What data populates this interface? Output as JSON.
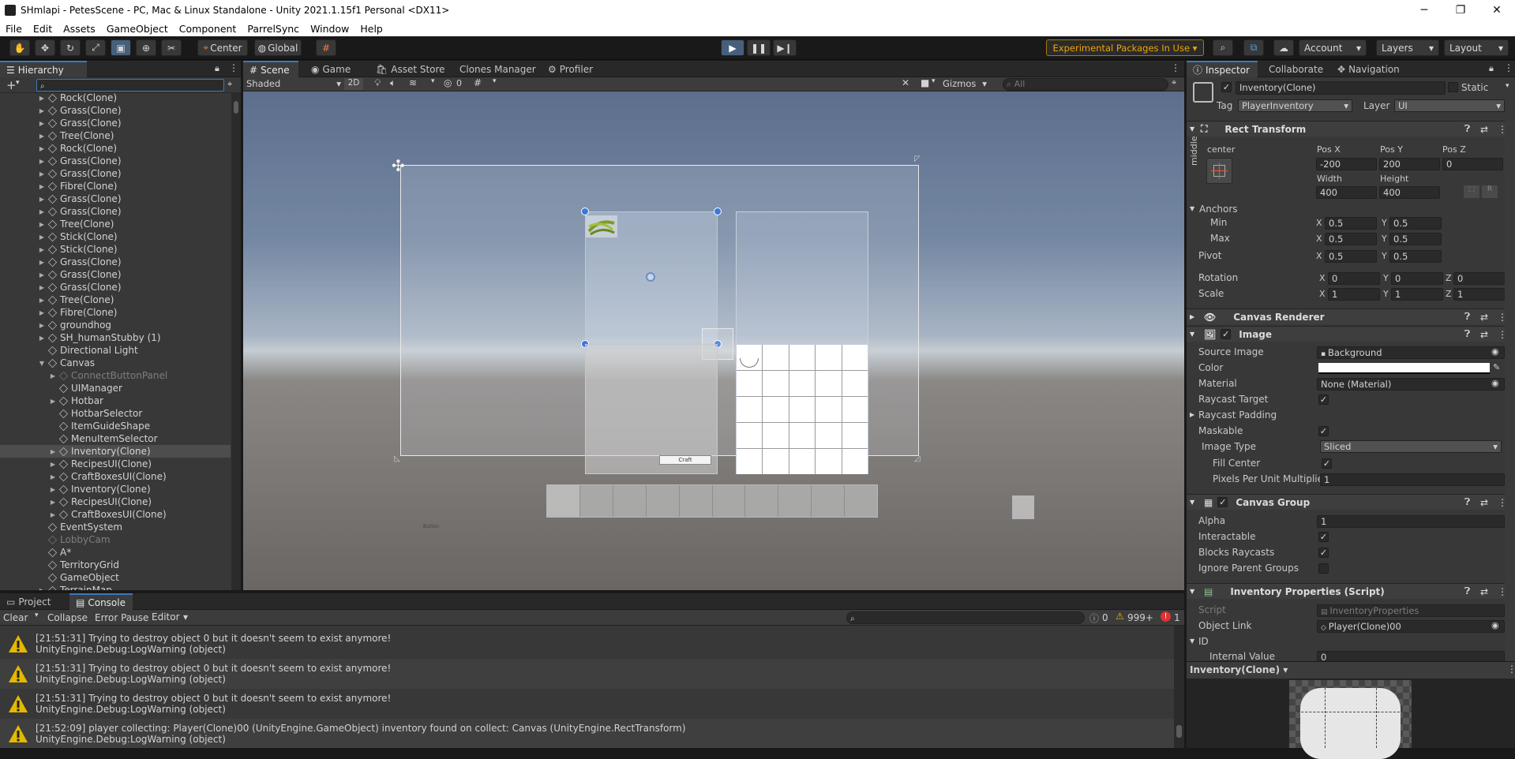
{
  "window": {
    "title": "SHmlapi - PetesScene - PC, Mac & Linux Standalone - Unity 2021.1.15f1 Personal <DX11>"
  },
  "menu": [
    "File",
    "Edit",
    "Assets",
    "GameObject",
    "Component",
    "ParrelSync",
    "Window",
    "Help"
  ],
  "toolbar": {
    "pivot_label": "Center",
    "space_label": "Global",
    "experimental_label": "Experimental Packages In Use ▾",
    "account_label": "Account",
    "layers_label": "Layers",
    "layout_label": "Layout"
  },
  "hierarchy": {
    "tab": "Hierarchy",
    "items": [
      {
        "label": "Rock(Clone)",
        "indent": 0,
        "fold": true,
        "dim": false
      },
      {
        "label": "Grass(Clone)",
        "indent": 0,
        "fold": true,
        "dim": false
      },
      {
        "label": "Grass(Clone)",
        "indent": 0,
        "fold": true,
        "dim": false
      },
      {
        "label": "Tree(Clone)",
        "indent": 0,
        "fold": true,
        "dim": false
      },
      {
        "label": "Rock(Clone)",
        "indent": 0,
        "fold": true,
        "dim": false
      },
      {
        "label": "Grass(Clone)",
        "indent": 0,
        "fold": true,
        "dim": false
      },
      {
        "label": "Grass(Clone)",
        "indent": 0,
        "fold": true,
        "dim": false
      },
      {
        "label": "Fibre(Clone)",
        "indent": 0,
        "fold": true,
        "dim": false
      },
      {
        "label": "Grass(Clone)",
        "indent": 0,
        "fold": true,
        "dim": false
      },
      {
        "label": "Grass(Clone)",
        "indent": 0,
        "fold": true,
        "dim": false
      },
      {
        "label": "Tree(Clone)",
        "indent": 0,
        "fold": true,
        "dim": false
      },
      {
        "label": "Stick(Clone)",
        "indent": 0,
        "fold": true,
        "dim": false
      },
      {
        "label": "Stick(Clone)",
        "indent": 0,
        "fold": true,
        "dim": false
      },
      {
        "label": "Grass(Clone)",
        "indent": 0,
        "fold": true,
        "dim": false
      },
      {
        "label": "Grass(Clone)",
        "indent": 0,
        "fold": true,
        "dim": false
      },
      {
        "label": "Grass(Clone)",
        "indent": 0,
        "fold": true,
        "dim": false
      },
      {
        "label": "Tree(Clone)",
        "indent": 0,
        "fold": true,
        "dim": false
      },
      {
        "label": "Fibre(Clone)",
        "indent": 0,
        "fold": true,
        "dim": false
      },
      {
        "label": "groundhog",
        "indent": 0,
        "fold": true,
        "dim": false
      },
      {
        "label": "SH_humanStubby (1)",
        "indent": 0,
        "fold": true,
        "dim": false
      },
      {
        "label": "Directional Light",
        "indent": 0,
        "fold": false,
        "dim": false
      },
      {
        "label": "Canvas",
        "indent": 0,
        "fold": "open",
        "dim": false
      },
      {
        "label": "ConnectButtonPanel",
        "indent": 1,
        "fold": true,
        "dim": true
      },
      {
        "label": "UIManager",
        "indent": 1,
        "fold": false,
        "dim": false
      },
      {
        "label": "Hotbar",
        "indent": 1,
        "fold": true,
        "dim": false
      },
      {
        "label": "HotbarSelector",
        "indent": 1,
        "fold": false,
        "dim": false
      },
      {
        "label": "ItemGuideShape",
        "indent": 1,
        "fold": false,
        "dim": false
      },
      {
        "label": "MenuItemSelector",
        "indent": 1,
        "fold": false,
        "dim": false
      },
      {
        "label": "Inventory(Clone)",
        "indent": 1,
        "fold": true,
        "dim": false,
        "selected": true
      },
      {
        "label": "RecipesUI(Clone)",
        "indent": 1,
        "fold": true,
        "dim": false
      },
      {
        "label": "CraftBoxesUI(Clone)",
        "indent": 1,
        "fold": true,
        "dim": false
      },
      {
        "label": "Inventory(Clone)",
        "indent": 1,
        "fold": true,
        "dim": false
      },
      {
        "label": "RecipesUI(Clone)",
        "indent": 1,
        "fold": true,
        "dim": false
      },
      {
        "label": "CraftBoxesUI(Clone)",
        "indent": 1,
        "fold": true,
        "dim": false
      },
      {
        "label": "EventSystem",
        "indent": 0,
        "fold": false,
        "dim": false
      },
      {
        "label": "LobbyCam",
        "indent": 0,
        "fold": false,
        "dim": true
      },
      {
        "label": "A*",
        "indent": 0,
        "fold": false,
        "dim": false
      },
      {
        "label": "TerritoryGrid",
        "indent": 0,
        "fold": false,
        "dim": false
      },
      {
        "label": "GameObject",
        "indent": 0,
        "fold": false,
        "dim": false
      },
      {
        "label": "TerrainMap",
        "indent": 0,
        "fold": true,
        "dim": false
      }
    ]
  },
  "scene": {
    "tabs": [
      "Scene",
      "Game",
      "Asset Store",
      "Clones Manager",
      "Profiler"
    ],
    "shading": "Shaded",
    "mode_2d": "2D",
    "hidden_count": "0",
    "gizmos": "Gizmos",
    "search_placeholder": "All",
    "craft_button": "Craft",
    "canvas_caption": "Button"
  },
  "inspector": {
    "tabs": [
      "Inspector",
      "Collaborate",
      "Navigation"
    ],
    "object_name": "Inventory(Clone)",
    "static_label": "Static",
    "tag_label": "Tag",
    "tag_value": "PlayerInventory",
    "layer_label": "Layer",
    "layer_value": "UI",
    "rect_transform": {
      "title": "Rect Transform",
      "anchor_h": "center",
      "anchor_v": "middle",
      "pos_x_label": "Pos X",
      "pos_x": "-200",
      "pos_y_label": "Pos Y",
      "pos_y": "200",
      "pos_z_label": "Pos Z",
      "pos_z": "0",
      "width_label": "Width",
      "width": "400",
      "height_label": "Height",
      "height": "400",
      "r_label": "R",
      "anchors_label": "Anchors",
      "min_label": "Min",
      "min_x": "0.5",
      "min_y": "0.5",
      "max_label": "Max",
      "max_x": "0.5",
      "max_y": "0.5",
      "pivot_label": "Pivot",
      "pivot_x": "0.5",
      "pivot_y": "0.5",
      "rotation_label": "Rotation",
      "rot_x": "0",
      "rot_y": "0",
      "rot_z": "0",
      "scale_label": "Scale",
      "scale_x": "1",
      "scale_y": "1",
      "scale_z": "1"
    },
    "canvas_renderer": {
      "title": "Canvas Renderer"
    },
    "image": {
      "title": "Image",
      "source_image_label": "Source Image",
      "source_image": "Background",
      "color_label": "Color",
      "material_label": "Material",
      "material": "None (Material)",
      "raycast_target_label": "Raycast Target",
      "raycast_padding_label": "Raycast Padding",
      "maskable_label": "Maskable",
      "image_type_label": "Image Type",
      "image_type": "Sliced",
      "fill_center_label": "Fill Center",
      "ppu_label": "Pixels Per Unit Multiplier",
      "ppu": "1"
    },
    "canvas_group": {
      "title": "Canvas Group",
      "alpha_label": "Alpha",
      "alpha": "1",
      "interactable_label": "Interactable",
      "blocks_raycasts_label": "Blocks Raycasts",
      "ignore_parent_label": "Ignore Parent Groups"
    },
    "inventory_props": {
      "title": "Inventory Properties (Script)",
      "script_label": "Script",
      "script": "InventoryProperties",
      "object_link_label": "Object Link",
      "object_link": "Player(Clone)00",
      "id_label": "ID",
      "internal_value_label": "Internal Value",
      "internal_value": "0"
    },
    "preview_label": "Inventory(Clone) ▾"
  },
  "console": {
    "tabs": [
      "Project",
      "Console"
    ],
    "clear_label": "Clear",
    "collapse_label": "Collapse",
    "error_pause_label": "Error Pause",
    "editor_label": "Editor",
    "log_count": "0",
    "warn_count": "999+",
    "error_count": "1",
    "entries": [
      {
        "line1": "[21:51:31] Trying to destroy object 0 but it doesn't seem to exist anymore!",
        "line2": "UnityEngine.Debug:LogWarning (object)"
      },
      {
        "line1": "[21:51:31] Trying to destroy object 0 but it doesn't seem to exist anymore!",
        "line2": "UnityEngine.Debug:LogWarning (object)"
      },
      {
        "line1": "[21:51:31] Trying to destroy object 0 but it doesn't seem to exist anymore!",
        "line2": "UnityEngine.Debug:LogWarning (object)"
      },
      {
        "line1": "[21:52:09] player collecting: Player(Clone)00 (UnityEngine.GameObject) inventory found on collect: Canvas (UnityEngine.RectTransform)",
        "line2": "UnityEngine.Debug:LogWarning (object)"
      }
    ]
  },
  "colors": {
    "accent": "#3a79bb",
    "warning": "#e5b800",
    "error": "#d33"
  }
}
